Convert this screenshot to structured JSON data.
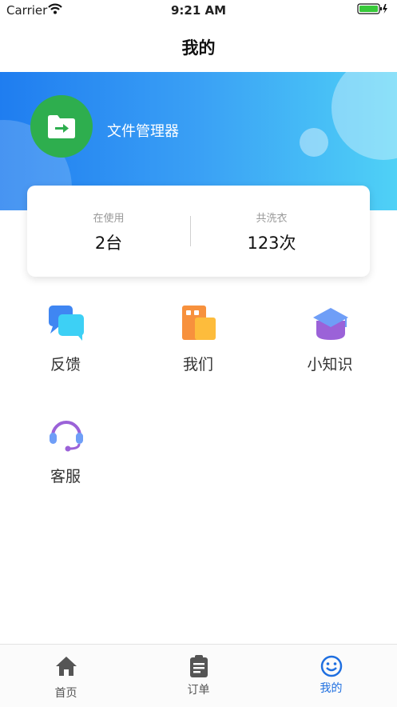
{
  "status_bar": {
    "carrier": "Carrier",
    "time": "9:21 AM"
  },
  "nav": {
    "title": "我的"
  },
  "profile": {
    "name": "文件管理器",
    "avatar_icon": "folder-arrow-icon",
    "avatar_color": "#2eae4e"
  },
  "stats": [
    {
      "label": "在使用",
      "value": "2台"
    },
    {
      "label": "共洗衣",
      "value": "123次"
    }
  ],
  "menu": [
    {
      "label": "反馈",
      "icon": "chat-bubbles-icon"
    },
    {
      "label": "我们",
      "icon": "building-icon"
    },
    {
      "label": "小知识",
      "icon": "graduation-cap-icon"
    },
    {
      "label": "客服",
      "icon": "headset-icon"
    }
  ],
  "tabs": [
    {
      "label": "首页",
      "icon": "home-icon",
      "active": false
    },
    {
      "label": "订单",
      "icon": "clipboard-icon",
      "active": false
    },
    {
      "label": "我的",
      "icon": "smiley-icon",
      "active": true
    }
  ],
  "colors": {
    "accent": "#1f7df0",
    "tab_inactive": "#555555",
    "tab_active": "#1f6fe0"
  }
}
